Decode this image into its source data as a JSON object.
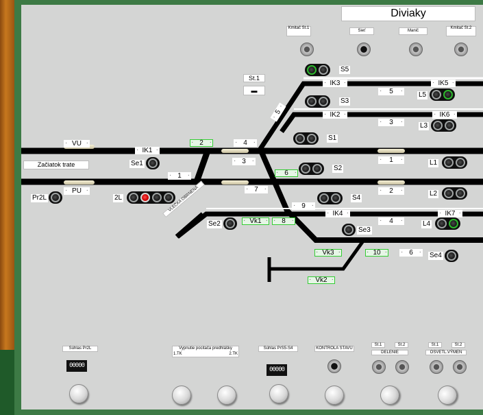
{
  "station_name": "Diviaky",
  "top_buttons": [
    {
      "label": "Kmitač St.1"
    },
    {
      "label": "Sieť"
    },
    {
      "label": "Manič"
    },
    {
      "label": "Kmitač St.2"
    }
  ],
  "st1_label": "St.1",
  "start_label": "Začiatok trate",
  "vu_label": "VU",
  "pu_label": "PU",
  "vlecka_label": "VLEČKA OBRNENÁ",
  "track_numbers": {
    "t1_left": "1",
    "t2_left": "2",
    "t3_left": "3",
    "t4_left": "4",
    "t5_diag": "5",
    "t6": "6",
    "t7": "7",
    "t8": "8",
    "t9": "9",
    "t10": "10",
    "t6b": "6",
    "r5": "5",
    "r3": "3",
    "r1": "1",
    "r2": "2",
    "r4": "4",
    "vk1": "Vk1",
    "vk2": "Vk2",
    "vk3": "Vk3"
  },
  "insulation": {
    "ik1": "IK1",
    "ik2": "IK2",
    "ik3": "IK3",
    "ik4": "IK4",
    "ik5": "IK5",
    "ik6": "IK6",
    "ik7": "IK7"
  },
  "signals": {
    "se1": "Se1",
    "pr2l": "Pr2L",
    "s2l": "2L",
    "se2": "Se2",
    "s5": "S5",
    "s3": "S3",
    "s1": "S1",
    "s2": "S2",
    "s4": "S4",
    "se3": "Se3",
    "se4": "Se4",
    "l5": "L5",
    "l3": "L3",
    "l1": "L1",
    "l2": "L2",
    "l4": "L4"
  },
  "bottom": {
    "suhlas_pr2l": "Súhlas Pr2L",
    "counter1": "00000",
    "vypnutie": "Vypnutie pocitača predhlášky",
    "tk1": "1.TK",
    "tk2": "2.TK",
    "suhlas_s5s4": "Súhlas PrS5-S4",
    "counter2": "00000",
    "kontrola": "KONTROLA STAVU",
    "st1a": "St.1",
    "st2a": "St.2",
    "delenie": "DELENIE",
    "st1b": "St.1",
    "st2b": "St.2",
    "osvetl": "OSVETL.VÝMEN"
  },
  "colors": {
    "panel": "#d4d5d4",
    "track": "#000000",
    "frame": "#3d7a45",
    "wood": "#c7781e",
    "red_lamp": "#cc0000",
    "green_ring": "#2db82d"
  }
}
